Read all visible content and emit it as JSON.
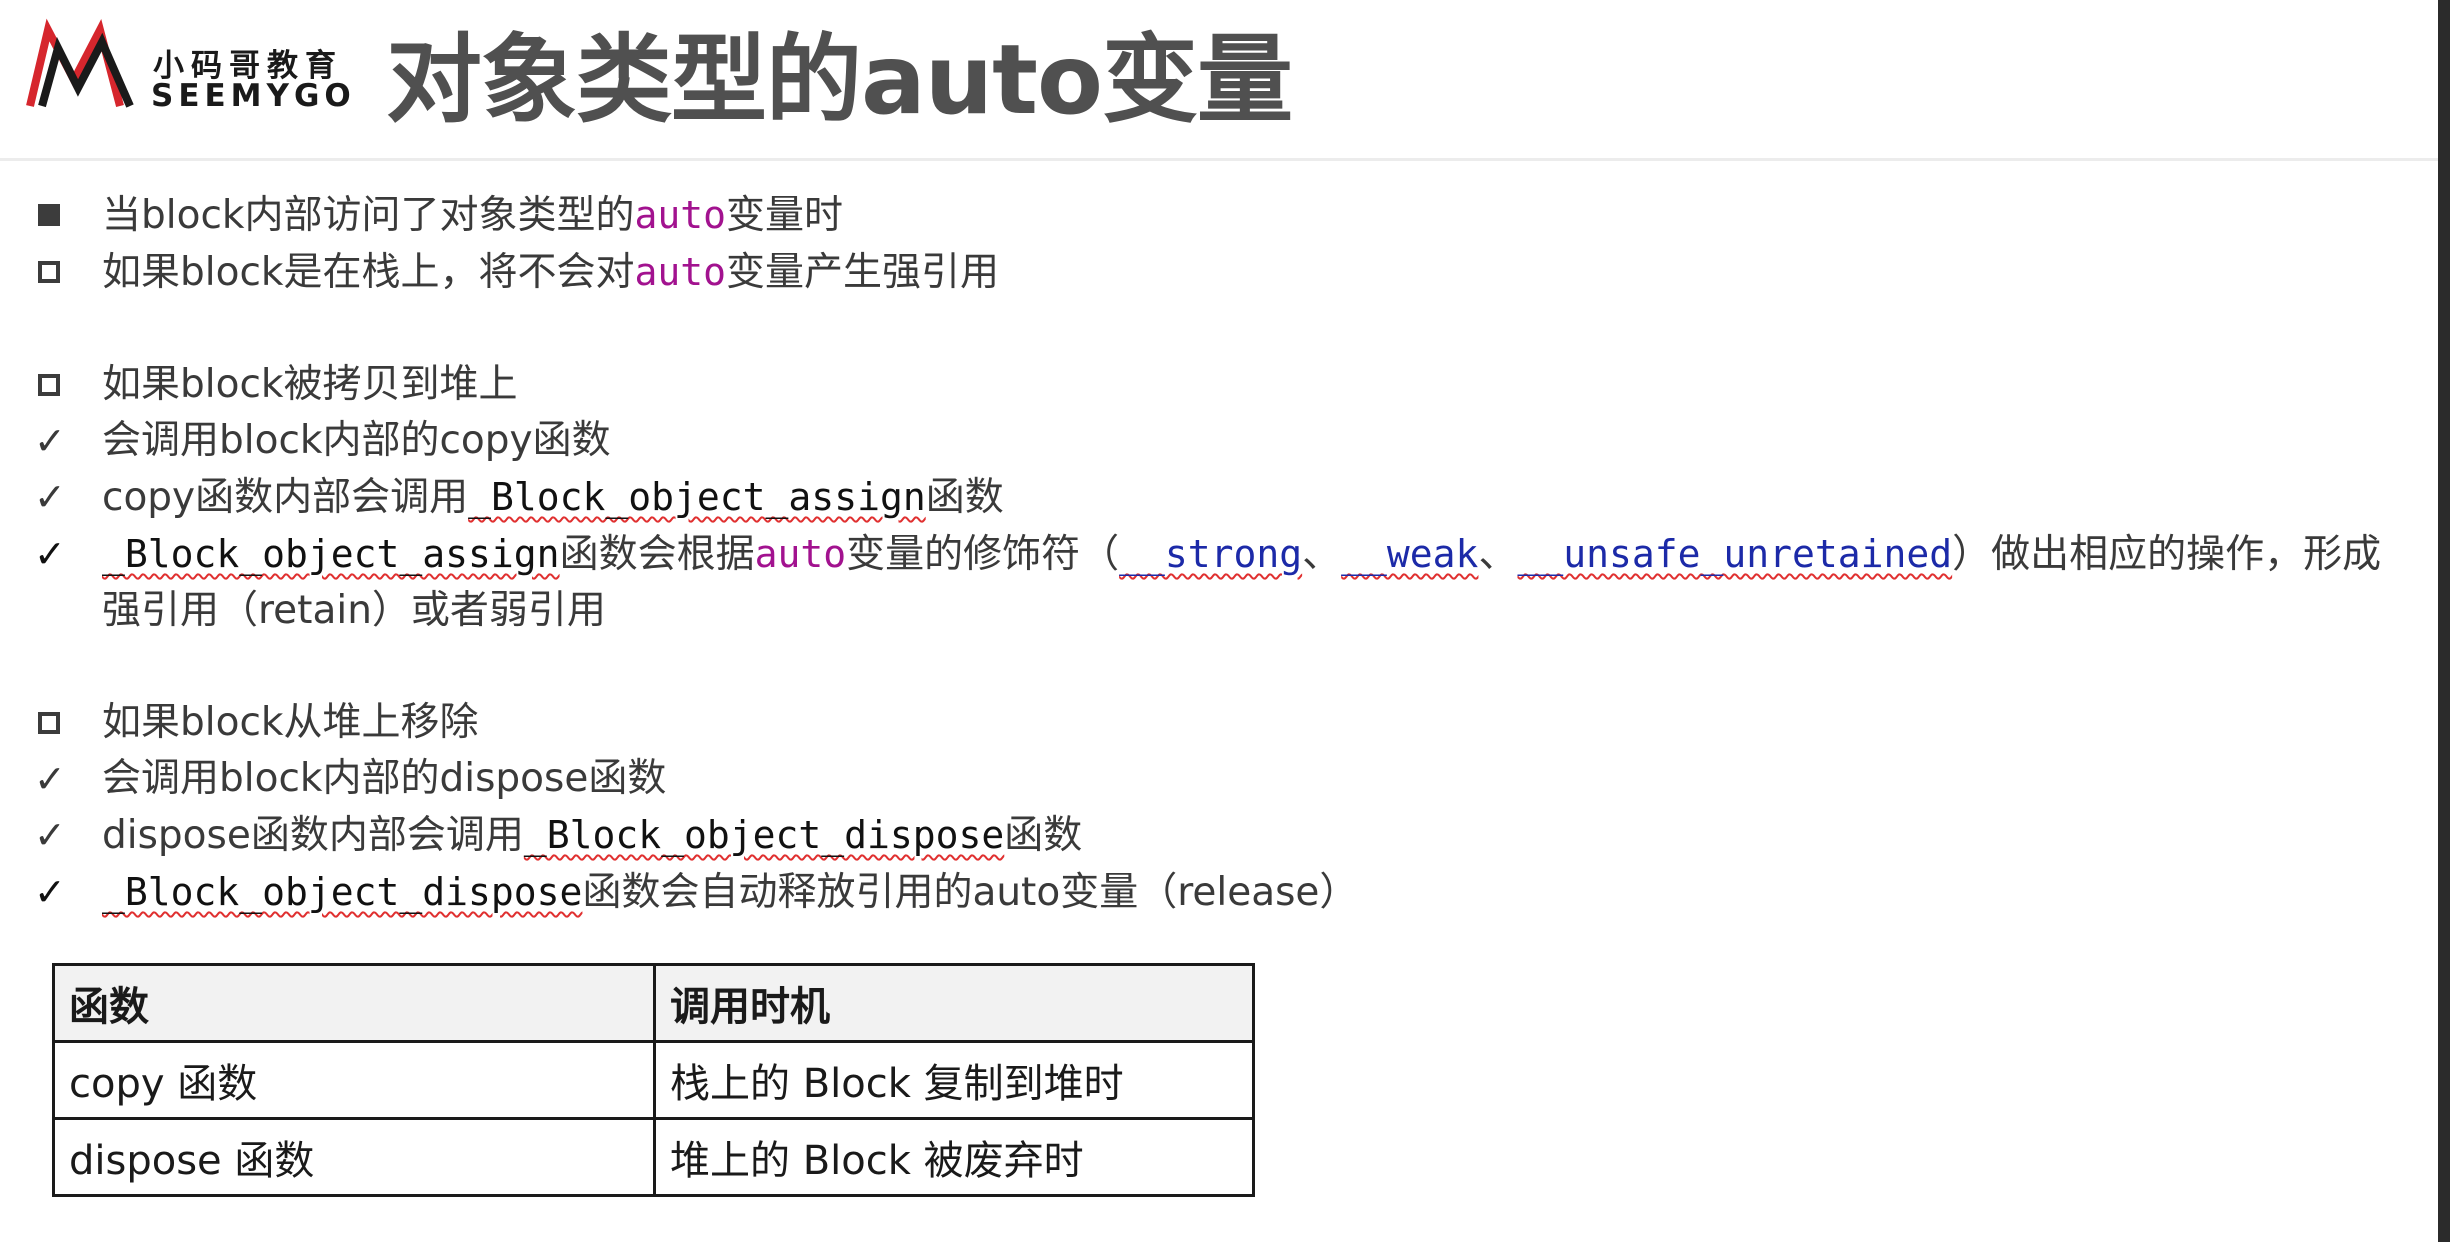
{
  "logo": {
    "cn": "小码哥教育",
    "en": "SEEMYGO"
  },
  "title": "对象类型的auto变量",
  "lines": {
    "l1_a": "当block内部访问了对象类型的",
    "l1_b": "auto",
    "l1_c": "变量时",
    "l2_a": "如果block是在栈上，将不会对",
    "l2_b": "auto",
    "l2_c": "变量产生强引用",
    "l3": "如果block被拷贝到堆上",
    "l4": "会调用block内部的copy函数",
    "l5_a": "copy函数内部会调用",
    "l5_b": "_Block_object_assign",
    "l5_c": "函数",
    "l6_a": "_Block_object_assign",
    "l6_b": "函数会根据",
    "l6_c": "auto",
    "l6_d": "变量的修饰符（",
    "l6_e": "__strong",
    "l6_f": "、",
    "l6_g": "__weak",
    "l6_h": "、",
    "l6_i": "__unsafe_unretained",
    "l6_j": "）做出相应的操作，形成强引用（retain）或者弱引用",
    "l7": "如果block从堆上移除",
    "l8": "会调用block内部的dispose函数",
    "l9_a": "dispose函数内部会调用",
    "l9_b": "_Block_object_dispose",
    "l9_c": "函数",
    "l10_a": "_Block_object_dispose",
    "l10_b": "函数会自动释放引用的auto变量（release）"
  },
  "table": {
    "headers": [
      "函数",
      "调用时机"
    ],
    "rows": [
      [
        "copy 函数",
        "栈上的 Block 复制到堆时"
      ],
      [
        "dispose 函数",
        "堆上的 Block 被废弃时"
      ]
    ]
  },
  "colors": {
    "keyword": "#a2128f",
    "qualifier": "#1c2aa8",
    "title": "#505050",
    "logo_red": "#d6262d"
  },
  "icons": {
    "logo": "seemygo-m-logo",
    "filled_bullet": "filled-square-icon",
    "hollow_bullet": "hollow-square-icon",
    "check": "checkmark-icon"
  }
}
